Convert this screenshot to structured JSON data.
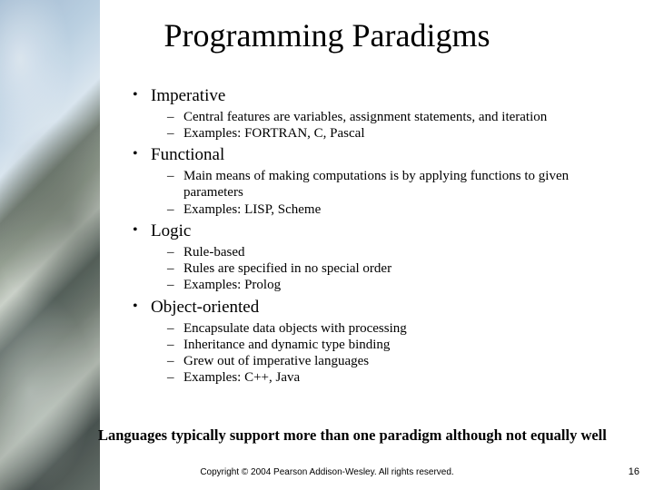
{
  "title": "Programming Paradigms",
  "bullets": [
    {
      "label": "Imperative",
      "sub": [
        "Central features are variables, assignment statements, and iteration",
        "Examples: FORTRAN, C, Pascal"
      ]
    },
    {
      "label": "Functional",
      "sub": [
        "Main means of making computations is by applying functions to given parameters",
        "Examples: LISP, Scheme"
      ]
    },
    {
      "label": "Logic",
      "sub": [
        "Rule-based",
        "Rules are specified in no special order",
        "Examples: Prolog"
      ]
    },
    {
      "label": "Object-oriented",
      "sub": [
        "Encapsulate data objects with processing",
        "Inheritance and dynamic type binding",
        "Grew out of imperative languages",
        "Examples: C++, Java"
      ]
    }
  ],
  "note": "Languages typically support more than one paradigm although not equally well",
  "copyright": "Copyright © 2004 Pearson Addison-Wesley. All rights reserved.",
  "page_number": "16"
}
